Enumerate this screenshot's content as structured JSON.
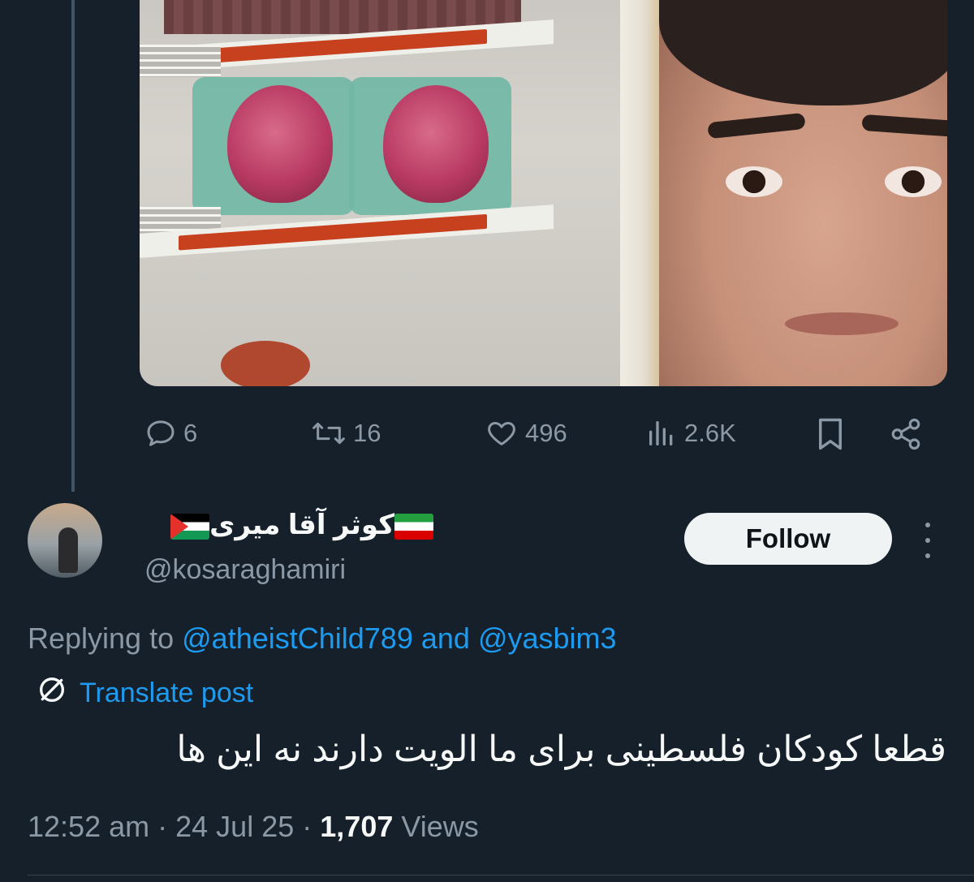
{
  "post_media": {
    "description_icon": "image-placeholder"
  },
  "actions": {
    "reply_count": "6",
    "repost_count": "16",
    "like_count": "496",
    "views_count": "2.6K"
  },
  "reply": {
    "display_name": "کوثر آقا میری",
    "handle": "@kosaraghamiri",
    "follow_label": "Follow",
    "replying_prefix": "Replying to",
    "replying_user_1": "@atheistChild789",
    "replying_and": "and",
    "replying_user_2": "@yasbim3",
    "translate_label": "Translate post",
    "text": "قطعا کودکان فلسطینی برای ما الویت دارند نه این ها",
    "time": "12:52 am",
    "date": "24 Jul 25",
    "views_number": "1,707",
    "views_label": "Views"
  },
  "colors": {
    "background": "#15202b",
    "accent": "#1d9bf0",
    "muted": "#8b98a5",
    "text": "#f7f9f9"
  }
}
